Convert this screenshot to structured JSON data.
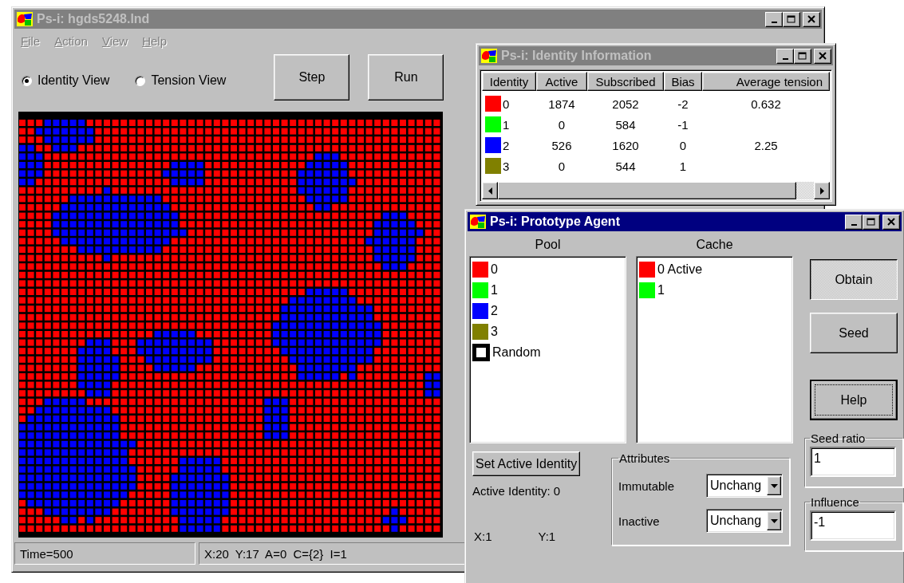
{
  "main_window": {
    "title": "Ps-i: hgds5248.lnd",
    "active": false,
    "menu": [
      {
        "label": "File",
        "disabled": true
      },
      {
        "label": "Action",
        "disabled": true
      },
      {
        "label": "View",
        "disabled": true
      },
      {
        "label": "Help",
        "disabled": true
      }
    ],
    "view_options": [
      {
        "label": "Identity View",
        "selected": true
      },
      {
        "label": "Tension View",
        "selected": false
      }
    ],
    "buttons": [
      "Step",
      "Run"
    ],
    "status_bar": [
      "Time=500",
      "X:20 Y:17 A=0 C={2} I=1"
    ]
  },
  "identity_window": {
    "title": "Ps-i: Identity Information",
    "active": false,
    "columns": [
      "Identity",
      "Active",
      "Subscribed",
      "Bias",
      "Average tension"
    ],
    "rows": [
      {
        "color": "#ff0000",
        "identity": "0",
        "active": "1874",
        "subscribed": "2052",
        "bias": "-2",
        "average_tension": "0.632"
      },
      {
        "color": "#00ff00",
        "identity": "1",
        "active": "0",
        "subscribed": "584",
        "bias": "-1"
      },
      {
        "color": "#0000ff",
        "identity": "2",
        "active": "526",
        "subscribed": "1620",
        "bias": "0",
        "average_tension": "2.25"
      },
      {
        "color": "#808000",
        "identity": "3",
        "active": "0",
        "subscribed": "544",
        "bias": "1"
      }
    ]
  },
  "agent_window": {
    "title": "Ps-i: Prototype Agent",
    "active": true,
    "pool": {
      "label": "Pool",
      "items": [
        {
          "kind": "swatch",
          "color": "#ff0000",
          "label": "0"
        },
        {
          "kind": "swatch",
          "color": "#00ff00",
          "label": "1"
        },
        {
          "kind": "swatch",
          "color": "#0000ff",
          "label": "2"
        },
        {
          "kind": "swatch",
          "color": "#808000",
          "label": "3"
        },
        {
          "kind": "random",
          "label": "Random"
        }
      ]
    },
    "cache": {
      "label": "Cache",
      "items": [
        {
          "kind": "swatch",
          "color": "#ff0000",
          "label": "0 Active"
        },
        {
          "kind": "swatch",
          "color": "#00ff00",
          "label": "1"
        }
      ]
    },
    "buttons": [
      {
        "label": "Obtain",
        "pressed": true,
        "focused": false
      },
      {
        "label": "Seed",
        "pressed": false,
        "focused": false
      },
      {
        "label": "Help",
        "pressed": false,
        "focused": true
      }
    ],
    "set_active_button": "Set Active Identity",
    "active_identity": "Active Identity: 0",
    "x": "X:1",
    "y": "Y:1",
    "attributes": {
      "title": "Attributes",
      "fields": [
        {
          "label": "Immutable",
          "value": "Unchang"
        },
        {
          "label": "Inactive",
          "value": "Unchang"
        }
      ]
    },
    "seed_ratio": {
      "title": "Seed ratio",
      "value": "1"
    },
    "influence": {
      "title": "Influence",
      "value": "-1"
    }
  }
}
